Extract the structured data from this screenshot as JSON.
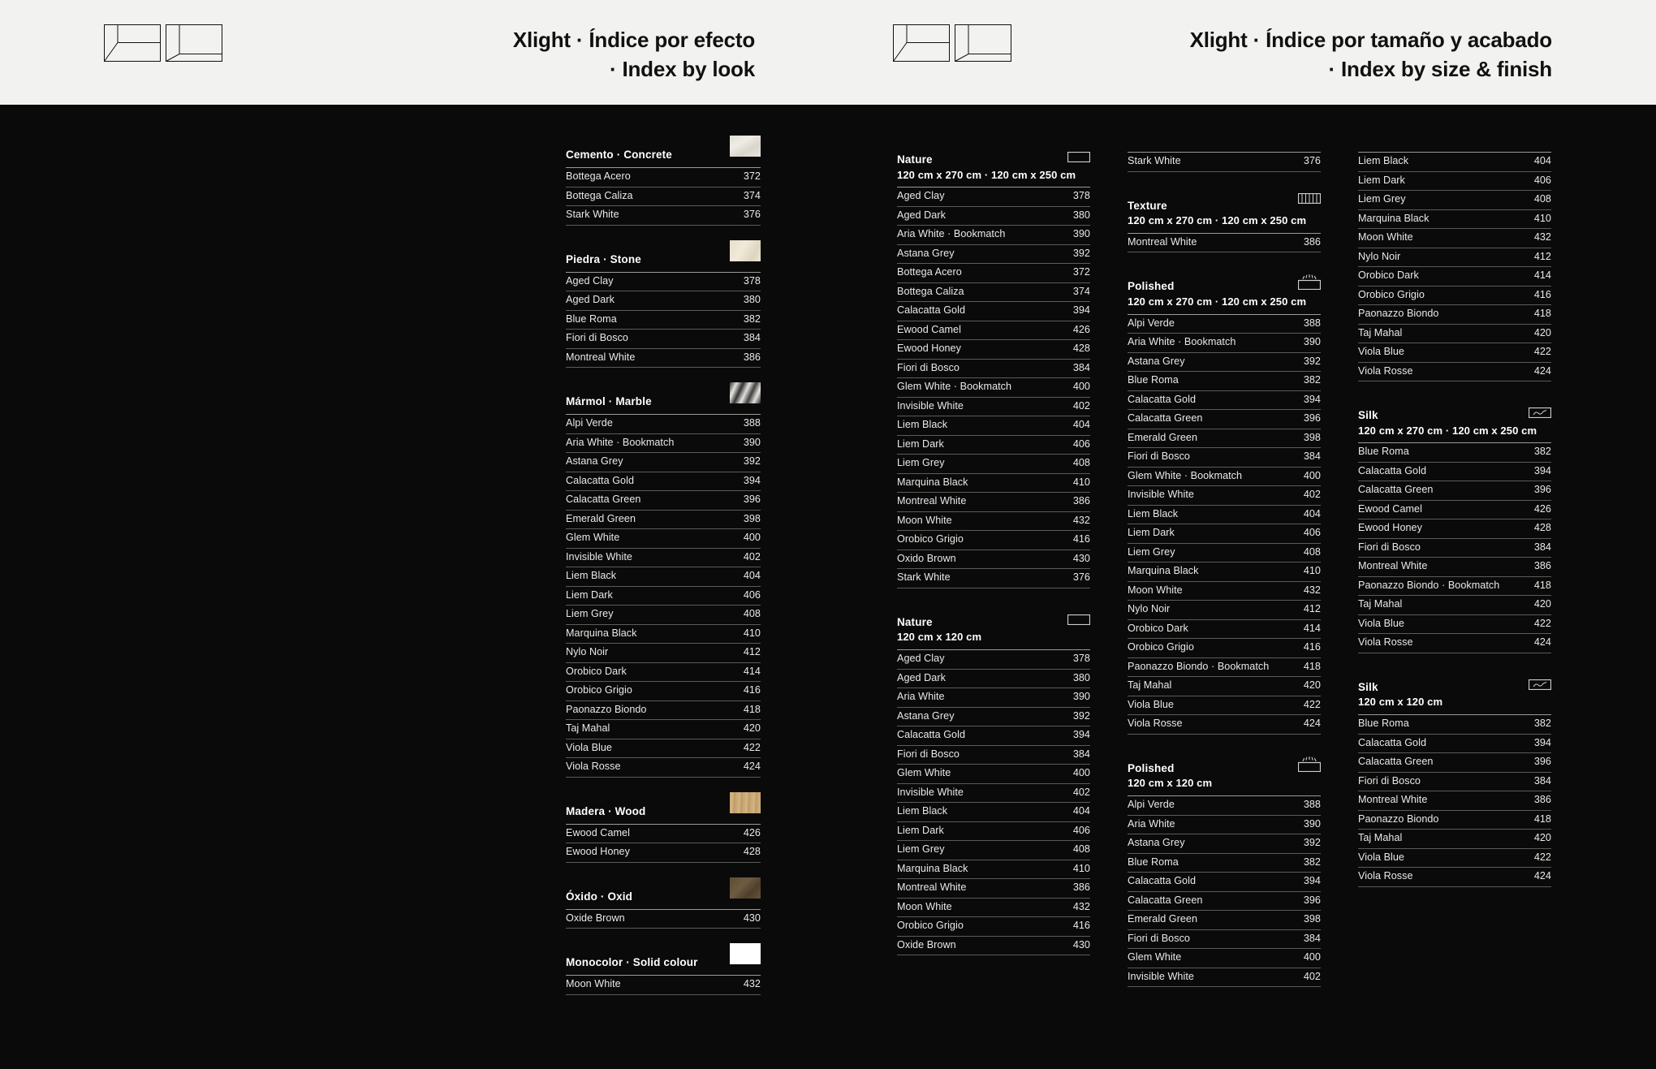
{
  "header": {
    "left": {
      "title_line1": "Xlight · Índice por efecto",
      "title_line2": "· Index by look",
      "logo_name": "xlight-slab-logo"
    },
    "right": {
      "title_line1": "Xlight · Índice por tamaño y acabado",
      "title_line2": "· Index by size & finish",
      "logo_name": "xlight-slab-logo"
    }
  },
  "colors": {
    "page_bg": "#0a0a0a",
    "header_bg": "#f2f2f0",
    "text": "#e9e9e7",
    "rule": "#5b5b58",
    "head_rule": "#9a9a96"
  },
  "columns": [
    {
      "id": "col1",
      "sections": [
        {
          "title": "Cemento · Concrete",
          "subtitle": "",
          "swatch": "sw-concrete",
          "icon": "",
          "rows": [
            {
              "name": "Bottega Acero",
              "page": "372"
            },
            {
              "name": "Bottega Caliza",
              "page": "374"
            },
            {
              "name": "Stark White",
              "page": "376"
            }
          ]
        },
        {
          "title": "Piedra · Stone",
          "subtitle": "",
          "swatch": "sw-stone",
          "icon": "",
          "rows": [
            {
              "name": "Aged Clay",
              "page": "378"
            },
            {
              "name": "Aged Dark",
              "page": "380"
            },
            {
              "name": "Blue Roma",
              "page": "382"
            },
            {
              "name": "Fiori di Bosco",
              "page": "384"
            },
            {
              "name": "Montreal White",
              "page": "386"
            }
          ]
        },
        {
          "title": "Mármol · Marble",
          "subtitle": "",
          "swatch": "sw-marble",
          "icon": "",
          "rows": [
            {
              "name": "Alpi Verde",
              "page": "388"
            },
            {
              "name": "Aria White · Bookmatch",
              "page": "390"
            },
            {
              "name": "Astana Grey",
              "page": "392"
            },
            {
              "name": "Calacatta Gold",
              "page": "394"
            },
            {
              "name": "Calacatta Green",
              "page": "396"
            },
            {
              "name": "Emerald Green",
              "page": "398"
            },
            {
              "name": "Glem White",
              "page": "400"
            },
            {
              "name": "Invisible White",
              "page": "402"
            },
            {
              "name": "Liem Black",
              "page": "404"
            },
            {
              "name": "Liem Dark",
              "page": "406"
            },
            {
              "name": "Liem Grey",
              "page": "408"
            },
            {
              "name": "Marquina Black",
              "page": "410"
            },
            {
              "name": "Nylo Noir",
              "page": "412"
            },
            {
              "name": "Orobico Dark",
              "page": "414"
            },
            {
              "name": "Orobico Grigio",
              "page": "416"
            },
            {
              "name": "Paonazzo Biondo",
              "page": "418"
            },
            {
              "name": "Taj Mahal",
              "page": "420"
            },
            {
              "name": "Viola Blue",
              "page": "422"
            },
            {
              "name": "Viola Rosse",
              "page": "424"
            }
          ]
        },
        {
          "title": "Madera · Wood",
          "subtitle": "",
          "swatch": "sw-wood",
          "icon": "",
          "rows": [
            {
              "name": "Ewood Camel",
              "page": "426"
            },
            {
              "name": "Ewood Honey",
              "page": "428"
            }
          ]
        },
        {
          "title": "Óxido · Oxid",
          "subtitle": "",
          "swatch": "sw-oxid",
          "icon": "",
          "rows": [
            {
              "name": "Oxide Brown",
              "page": "430"
            }
          ]
        },
        {
          "title": "Monocolor · Solid colour",
          "subtitle": "",
          "swatch": "sw-solid",
          "icon": "",
          "rows": [
            {
              "name": "Moon White",
              "page": "432"
            }
          ]
        }
      ]
    },
    {
      "id": "col2",
      "sections": [
        {
          "title": "Nature",
          "subtitle": "120 cm x 270 cm · 120 cm x 250 cm",
          "swatch": "",
          "icon": "nature-icon",
          "rows": [
            {
              "name": "Aged Clay",
              "page": "378"
            },
            {
              "name": "Aged Dark",
              "page": "380"
            },
            {
              "name": "Aria White · Bookmatch",
              "page": "390"
            },
            {
              "name": "Astana Grey",
              "page": "392"
            },
            {
              "name": "Bottega Acero",
              "page": "372"
            },
            {
              "name": "Bottega Caliza",
              "page": "374"
            },
            {
              "name": "Calacatta Gold",
              "page": "394"
            },
            {
              "name": "Ewood Camel",
              "page": "426"
            },
            {
              "name": "Ewood Honey",
              "page": "428"
            },
            {
              "name": "Fiori di Bosco",
              "page": "384"
            },
            {
              "name": "Glem White · Bookmatch",
              "page": "400"
            },
            {
              "name": "Invisible White",
              "page": "402"
            },
            {
              "name": "Liem Black",
              "page": "404"
            },
            {
              "name": "Liem Dark",
              "page": "406"
            },
            {
              "name": "Liem Grey",
              "page": "408"
            },
            {
              "name": "Marquina Black",
              "page": "410"
            },
            {
              "name": "Montreal White",
              "page": "386"
            },
            {
              "name": "Moon White",
              "page": "432"
            },
            {
              "name": "Orobico Grigio",
              "page": "416"
            },
            {
              "name": "Oxido Brown",
              "page": "430"
            },
            {
              "name": "Stark White",
              "page": "376"
            }
          ]
        },
        {
          "title": "Nature",
          "subtitle": "120 cm x 120 cm",
          "swatch": "",
          "icon": "nature-icon",
          "rows": [
            {
              "name": "Aged Clay",
              "page": "378"
            },
            {
              "name": "Aged Dark",
              "page": "380"
            },
            {
              "name": "Aria White",
              "page": "390"
            },
            {
              "name": "Astana Grey",
              "page": "392"
            },
            {
              "name": "Calacatta Gold",
              "page": "394"
            },
            {
              "name": "Fiori di Bosco",
              "page": "384"
            },
            {
              "name": "Glem White",
              "page": "400"
            },
            {
              "name": "Invisible White",
              "page": "402"
            },
            {
              "name": "Liem Black",
              "page": "404"
            },
            {
              "name": "Liem Dark",
              "page": "406"
            },
            {
              "name": "Liem Grey",
              "page": "408"
            },
            {
              "name": "Marquina Black",
              "page": "410"
            },
            {
              "name": "Montreal White",
              "page": "386"
            },
            {
              "name": "Moon White",
              "page": "432"
            },
            {
              "name": "Orobico Grigio",
              "page": "416"
            },
            {
              "name": "Oxide Brown",
              "page": "430"
            }
          ]
        }
      ]
    },
    {
      "id": "col3",
      "sections": [
        {
          "title": "",
          "subtitle": "",
          "swatch": "",
          "icon": "",
          "continued": true,
          "rows": [
            {
              "name": "Stark White",
              "page": "376"
            }
          ]
        },
        {
          "title": "Texture",
          "subtitle": "120 cm x 270 cm · 120 cm x 250 cm",
          "swatch": "",
          "icon": "texture-icon",
          "rows": [
            {
              "name": "Montreal White",
              "page": "386"
            }
          ]
        },
        {
          "title": "Polished",
          "subtitle": "120 cm x 270 cm · 120 cm x 250 cm",
          "swatch": "",
          "icon": "polished-icon",
          "rows": [
            {
              "name": "Alpi Verde",
              "page": "388"
            },
            {
              "name": "Aria White · Bookmatch",
              "page": "390"
            },
            {
              "name": "Astana Grey",
              "page": "392"
            },
            {
              "name": "Blue Roma",
              "page": "382"
            },
            {
              "name": "Calacatta Gold",
              "page": "394"
            },
            {
              "name": "Calacatta Green",
              "page": "396"
            },
            {
              "name": "Emerald Green",
              "page": "398"
            },
            {
              "name": "Fiori di Bosco",
              "page": "384"
            },
            {
              "name": "Glem White · Bookmatch",
              "page": "400"
            },
            {
              "name": "Invisible White",
              "page": "402"
            },
            {
              "name": "Liem Black",
              "page": "404"
            },
            {
              "name": "Liem Dark",
              "page": "406"
            },
            {
              "name": "Liem Grey",
              "page": "408"
            },
            {
              "name": "Marquina Black",
              "page": "410"
            },
            {
              "name": "Moon White",
              "page": "432"
            },
            {
              "name": "Nylo Noir",
              "page": "412"
            },
            {
              "name": "Orobico Dark",
              "page": "414"
            },
            {
              "name": "Orobico Grigio",
              "page": "416"
            },
            {
              "name": "Paonazzo Biondo · Bookmatch",
              "page": "418"
            },
            {
              "name": "Taj Mahal",
              "page": "420"
            },
            {
              "name": "Viola Blue",
              "page": "422"
            },
            {
              "name": "Viola Rosse",
              "page": "424"
            }
          ]
        },
        {
          "title": "Polished",
          "subtitle": "120 cm x 120 cm",
          "swatch": "",
          "icon": "polished-icon",
          "rows": [
            {
              "name": "Alpi Verde",
              "page": "388"
            },
            {
              "name": "Aria White",
              "page": "390"
            },
            {
              "name": "Astana Grey",
              "page": "392"
            },
            {
              "name": "Blue Roma",
              "page": "382"
            },
            {
              "name": "Calacatta Gold",
              "page": "394"
            },
            {
              "name": "Calacatta Green",
              "page": "396"
            },
            {
              "name": "Emerald Green",
              "page": "398"
            },
            {
              "name": "Fiori di Bosco",
              "page": "384"
            },
            {
              "name": "Glem White",
              "page": "400"
            },
            {
              "name": "Invisible White",
              "page": "402"
            }
          ]
        }
      ]
    },
    {
      "id": "col4",
      "sections": [
        {
          "title": "",
          "subtitle": "",
          "swatch": "",
          "icon": "",
          "continued": true,
          "rows": [
            {
              "name": "Liem Black",
              "page": "404"
            },
            {
              "name": "Liem Dark",
              "page": "406"
            },
            {
              "name": "Liem Grey",
              "page": "408"
            },
            {
              "name": "Marquina Black",
              "page": "410"
            },
            {
              "name": "Moon White",
              "page": "432"
            },
            {
              "name": "Nylo Noir",
              "page": "412"
            },
            {
              "name": "Orobico Dark",
              "page": "414"
            },
            {
              "name": "Orobico Grigio",
              "page": "416"
            },
            {
              "name": "Paonazzo Biondo",
              "page": "418"
            },
            {
              "name": "Taj Mahal",
              "page": "420"
            },
            {
              "name": "Viola Blue",
              "page": "422"
            },
            {
              "name": "Viola Rosse",
              "page": "424"
            }
          ]
        },
        {
          "title": "Silk",
          "subtitle": "120 cm x 270 cm · 120 cm x 250 cm",
          "swatch": "",
          "icon": "silk-icon",
          "rows": [
            {
              "name": "Blue Roma",
              "page": "382"
            },
            {
              "name": "Calacatta Gold",
              "page": "394"
            },
            {
              "name": "Calacatta Green",
              "page": "396"
            },
            {
              "name": "Ewood Camel",
              "page": "426"
            },
            {
              "name": "Ewood Honey",
              "page": "428"
            },
            {
              "name": "Fiori di Bosco",
              "page": "384"
            },
            {
              "name": "Montreal White",
              "page": "386"
            },
            {
              "name": "Paonazzo Biondo · Bookmatch",
              "page": "418"
            },
            {
              "name": "Taj Mahal",
              "page": "420"
            },
            {
              "name": "Viola Blue",
              "page": "422"
            },
            {
              "name": "Viola Rosse",
              "page": "424"
            }
          ]
        },
        {
          "title": "Silk",
          "subtitle": "120 cm x 120 cm",
          "swatch": "",
          "icon": "silk-icon",
          "rows": [
            {
              "name": "Blue Roma",
              "page": "382"
            },
            {
              "name": "Calacatta Gold",
              "page": "394"
            },
            {
              "name": "Calacatta Green",
              "page": "396"
            },
            {
              "name": "Fiori di Bosco",
              "page": "384"
            },
            {
              "name": "Montreal White",
              "page": "386"
            },
            {
              "name": "Paonazzo Biondo",
              "page": "418"
            },
            {
              "name": "Taj Mahal",
              "page": "420"
            },
            {
              "name": "Viola Blue",
              "page": "422"
            },
            {
              "name": "Viola Rosse",
              "page": "424"
            }
          ]
        }
      ]
    }
  ]
}
